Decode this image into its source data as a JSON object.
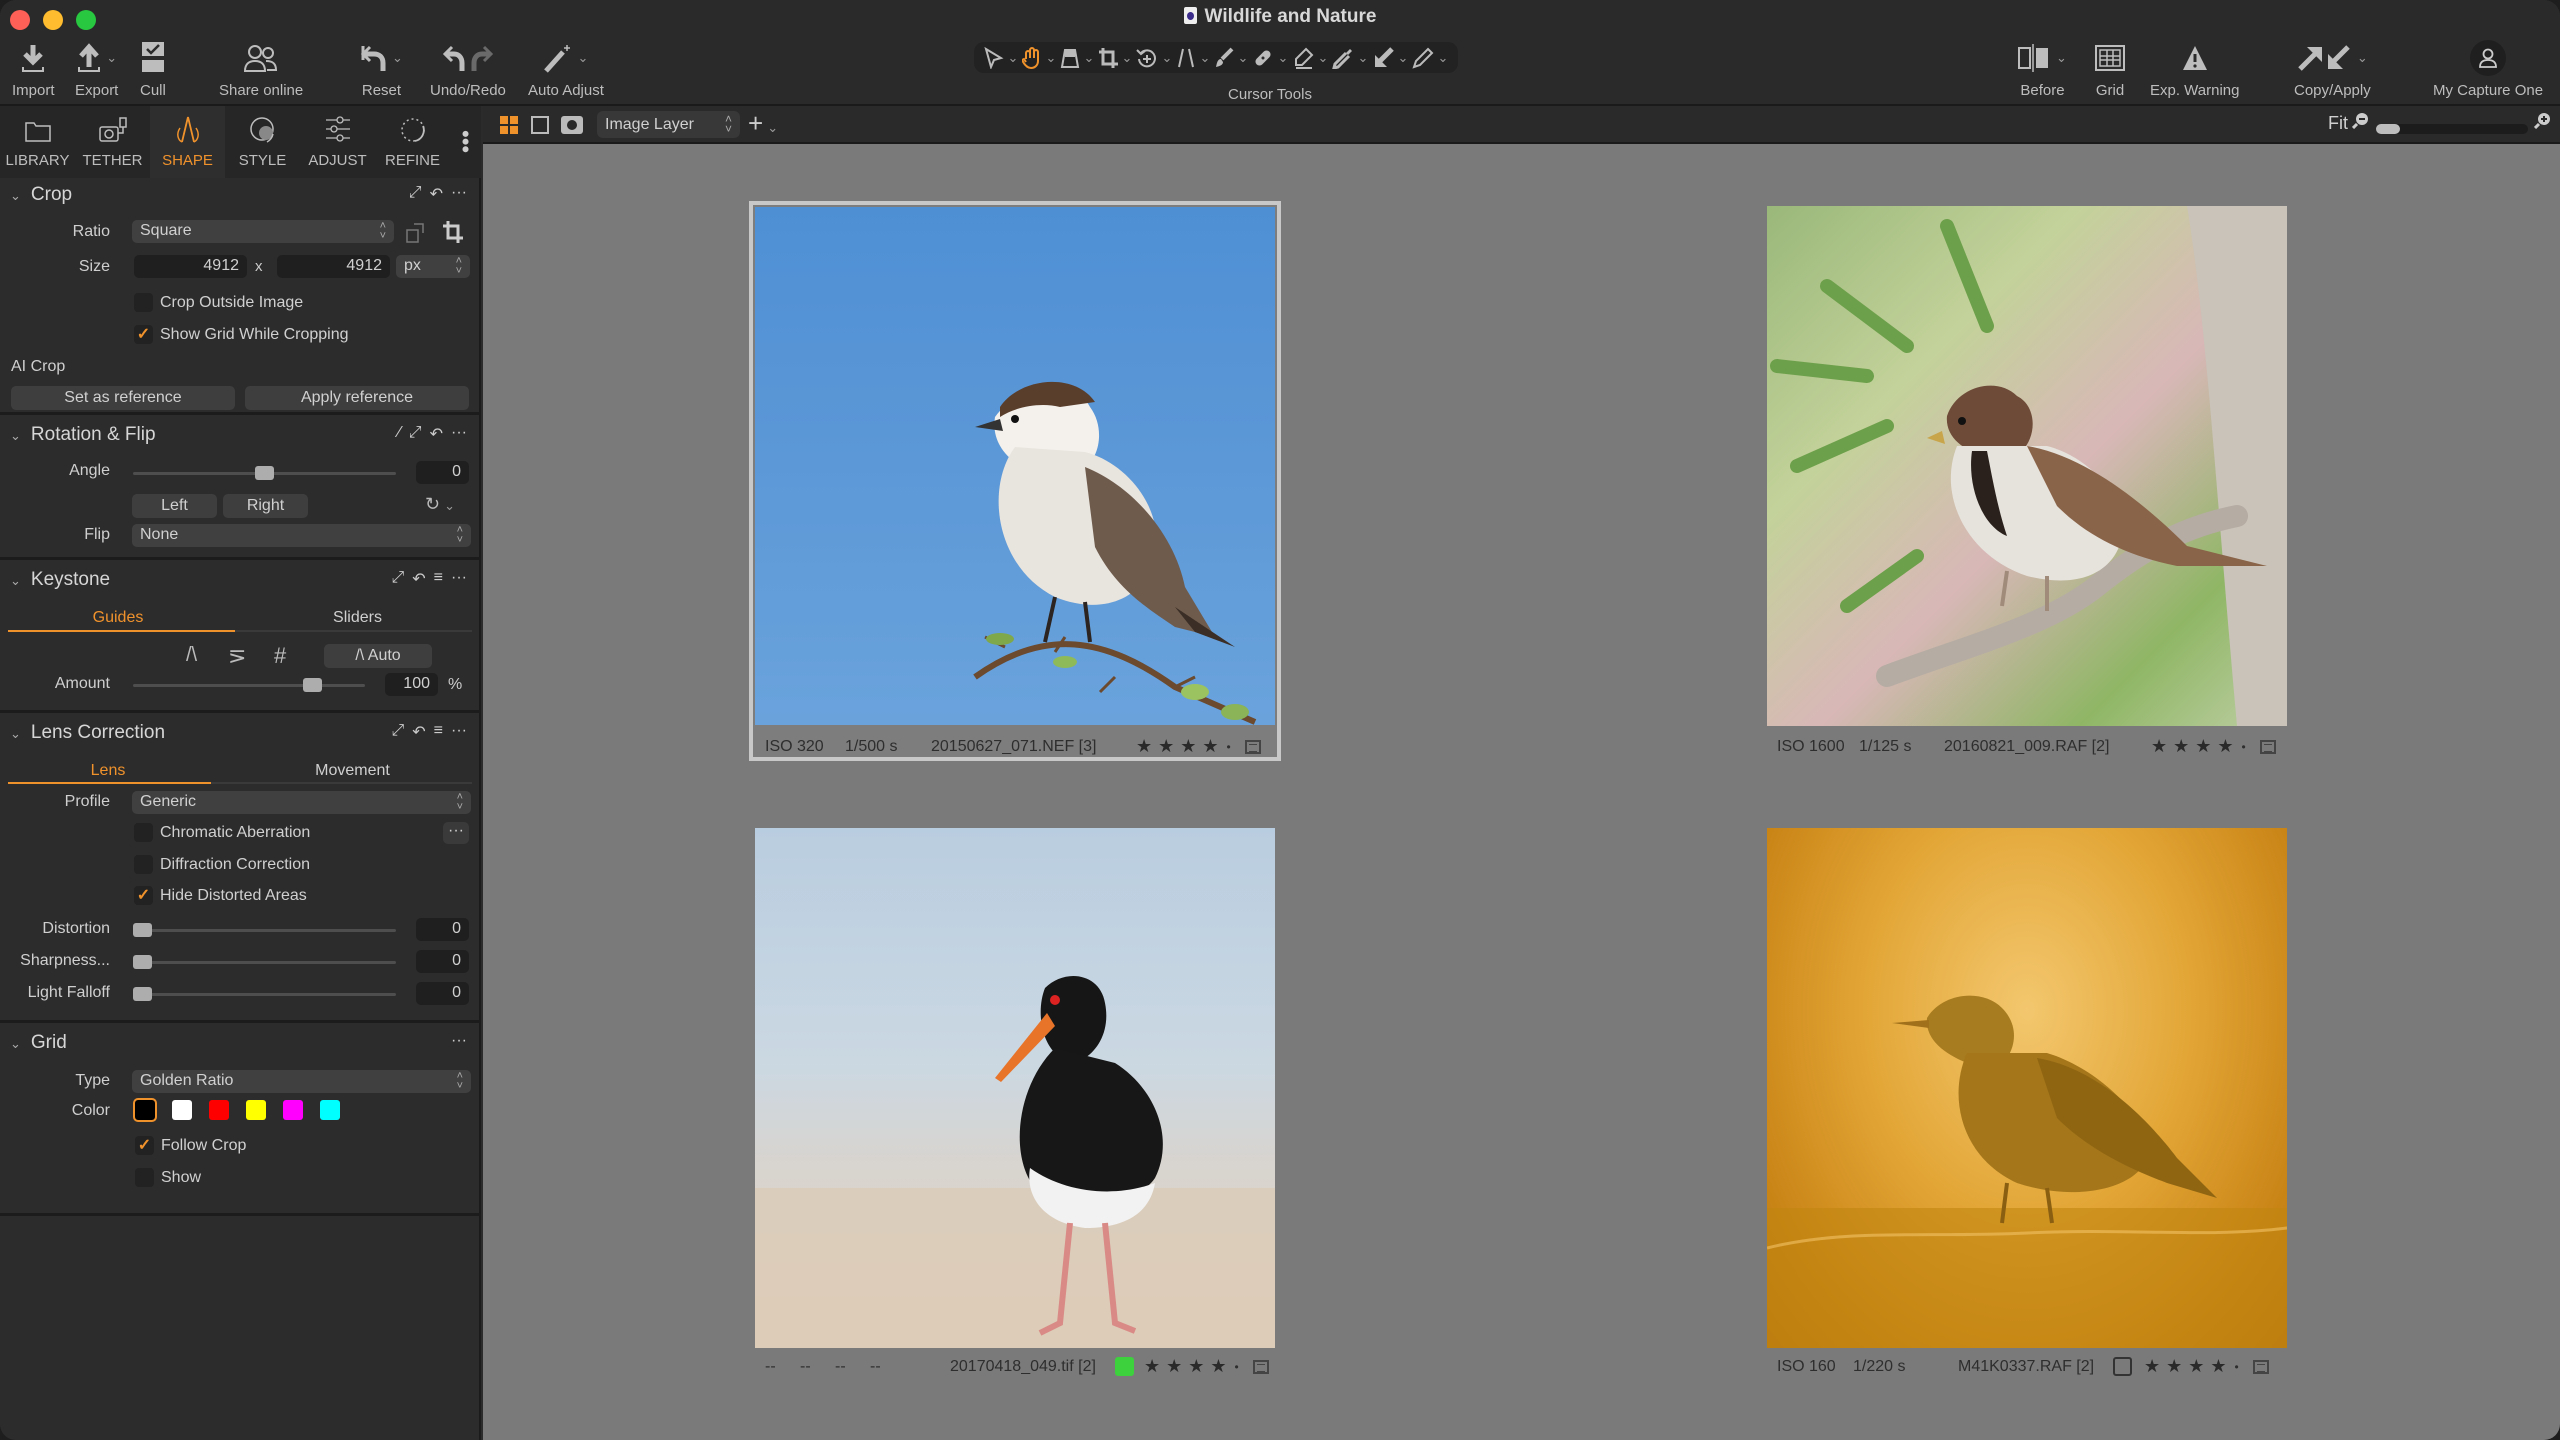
{
  "window": {
    "title": "Wildlife and Nature"
  },
  "toolbar": {
    "left": [
      {
        "id": "import",
        "label": "Import",
        "icon": "import-icon"
      },
      {
        "id": "export",
        "label": "Export",
        "icon": "export-icon"
      },
      {
        "id": "cull",
        "label": "Cull",
        "icon": "cull-icon"
      },
      {
        "id": "share",
        "label": "Share online",
        "icon": "share-online-icon"
      },
      {
        "id": "reset",
        "label": "Reset",
        "icon": "reset-icon"
      },
      {
        "id": "undoredo",
        "label": "Undo/Redo",
        "icon": "undo-redo-icon"
      },
      {
        "id": "autoadjust",
        "label": "Auto Adjust",
        "icon": "magic-wand-icon"
      }
    ],
    "cursor_tools_label": "Cursor Tools",
    "cursor_tools": [
      "select",
      "pan",
      "loupe",
      "crop",
      "rotate",
      "keystone",
      "brush",
      "heal",
      "eraser",
      "color-picker",
      "copy-apply",
      "annotate"
    ],
    "active_cursor_tool": "pan",
    "right": [
      {
        "id": "before",
        "label": "Before",
        "icon": "before-after-icon"
      },
      {
        "id": "grid",
        "label": "Grid",
        "icon": "grid-icon"
      },
      {
        "id": "expwarn",
        "label": "Exp. Warning",
        "icon": "warning-icon"
      },
      {
        "id": "copyapply",
        "label": "Copy/Apply",
        "icon": "copy-apply-icon"
      },
      {
        "id": "mycapture",
        "label": "My Capture One",
        "icon": "user-icon"
      }
    ]
  },
  "tool_tabs": [
    {
      "label": "LIBRARY",
      "icon": "folder-icon"
    },
    {
      "label": "TETHER",
      "icon": "camera-tether-icon"
    },
    {
      "label": "SHAPE",
      "icon": "shape-icon",
      "active": true
    },
    {
      "label": "STYLE",
      "icon": "style-icon"
    },
    {
      "label": "ADJUST",
      "icon": "sliders-icon"
    },
    {
      "label": "REFINE",
      "icon": "refine-icon"
    }
  ],
  "viewer_bar": {
    "layer": "Image Layer",
    "fit": "Fit",
    "zoom_level": 0.1
  },
  "crop": {
    "title": "Crop",
    "ratio_label": "Ratio",
    "ratio": "Square",
    "size_label": "Size",
    "width": "4912",
    "x": "x",
    "height": "4912",
    "unit": "px",
    "crop_outside": {
      "label": "Crop Outside Image",
      "checked": false
    },
    "show_grid": {
      "label": "Show Grid While Cropping",
      "checked": true
    },
    "ai_crop_label": "AI Crop",
    "set_reference": "Set as reference",
    "apply_reference": "Apply reference"
  },
  "rotation": {
    "title": "Rotation & Flip",
    "angle_label": "Angle",
    "angle": "0",
    "angle_fraction": 0.5,
    "left": "Left",
    "right": "Right",
    "flip_label": "Flip",
    "flip": "None"
  },
  "keystone": {
    "title": "Keystone",
    "tabs": [
      "Guides",
      "Sliders"
    ],
    "active_tab": "Guides",
    "auto": "Auto",
    "amount_label": "Amount",
    "amount": "100",
    "amount_unit": "%",
    "amount_fraction": 0.8
  },
  "lens": {
    "title": "Lens Correction",
    "tabs": [
      "Lens",
      "Movement"
    ],
    "active_tab": "Lens",
    "profile_label": "Profile",
    "profile": "Generic",
    "chromatic": {
      "label": "Chromatic Aberration",
      "checked": false
    },
    "diffraction": {
      "label": "Diffraction Correction",
      "checked": false
    },
    "hide_distorted": {
      "label": "Hide Distorted Areas",
      "checked": true
    },
    "sliders": [
      {
        "label": "Distortion",
        "value": "0"
      },
      {
        "label": "Sharpness...",
        "value": "0"
      },
      {
        "label": "Light Falloff",
        "value": "0"
      }
    ]
  },
  "grid": {
    "title": "Grid",
    "type_label": "Type",
    "type": "Golden Ratio",
    "color_label": "Color",
    "colors": [
      "#000000",
      "#ffffff",
      "#ff0000",
      "#ffff00",
      "#ff00ff",
      "#00ffff"
    ],
    "selected_color": "#000000",
    "follow_crop": {
      "label": "Follow Crop",
      "checked": true
    },
    "show": {
      "label": "Show",
      "checked": false
    }
  },
  "thumbnails": [
    {
      "iso": "ISO 320",
      "shutter": "1/500 s",
      "filename": "20150627_071.NEF [3]",
      "rating": 4,
      "color_tag": null,
      "selected": true
    },
    {
      "iso": "ISO 1600",
      "shutter": "1/125 s",
      "filename": "20160821_009.RAF [2]",
      "rating": 4,
      "color_tag": null,
      "selected": false
    },
    {
      "iso": "--",
      "shutter": "--",
      "extra1": "--",
      "extra2": "--",
      "filename": "20170418_049.tif [2]",
      "rating": 4,
      "color_tag": "#3ed13e",
      "selected": false
    },
    {
      "iso": "ISO 160",
      "shutter": "1/220 s",
      "filename": "M41K0337.RAF [2]",
      "rating": 4,
      "color_tag": "empty",
      "selected": false
    }
  ],
  "stars_text": "★★★★",
  "accent": "#f0922c"
}
